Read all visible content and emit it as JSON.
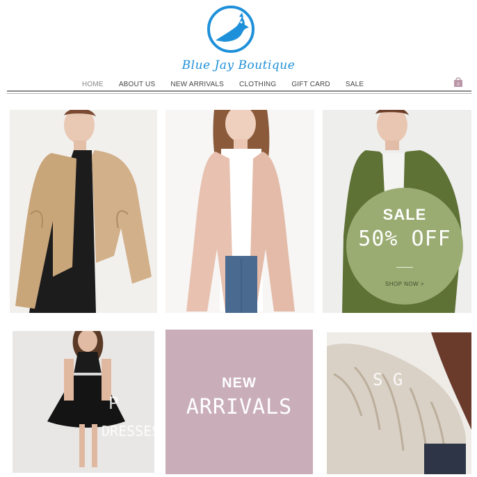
{
  "brand": {
    "name": "Blue Jay Boutique",
    "accent_color": "#1e90d9"
  },
  "nav": {
    "items": [
      {
        "label": "HOME",
        "active": true
      },
      {
        "label": "ABOUT US",
        "active": false
      },
      {
        "label": "NEW ARRIVALS",
        "active": false
      },
      {
        "label": "CLOTHING",
        "active": false
      },
      {
        "label": "GIFT CARD",
        "active": false
      },
      {
        "label": "SALE",
        "active": false
      }
    ],
    "cart_icon": "shopping-bag-icon"
  },
  "tiles": {
    "sale": {
      "title": "SALE",
      "discount": "50% OFF",
      "cta": "SHOP NOW >",
      "circle_color": "#9aac72"
    },
    "new_arrivals": {
      "line1": "NEW",
      "line2": "ARRIVALS",
      "bg_color": "#c9aeb9"
    },
    "dresses": {
      "line1": "P",
      "line2": "DRESSES"
    },
    "sweaters": {
      "line1": "S  G"
    }
  }
}
